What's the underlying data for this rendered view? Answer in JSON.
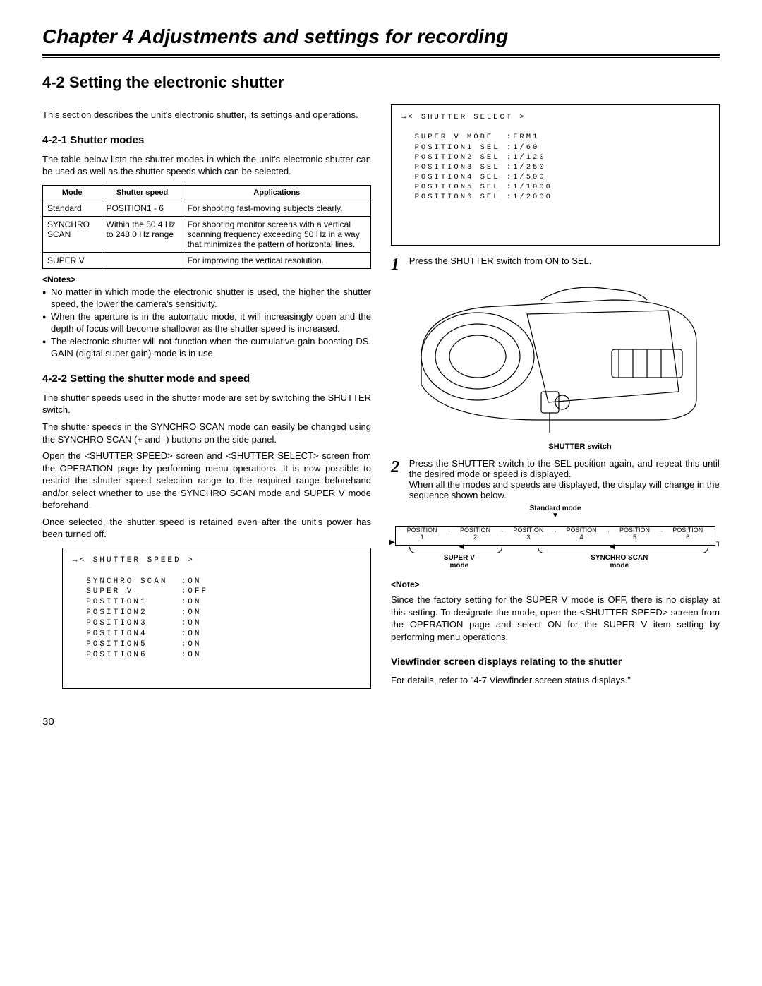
{
  "chapter_title": "Chapter 4  Adjustments and settings for recording",
  "section_title": "4-2 Setting the electronic shutter",
  "intro": "This section describes the unit's electronic shutter, its settings and operations.",
  "sub_4_2_1": "4-2-1 Shutter modes",
  "modes_intro": "The table below lists the shutter modes in which the unit's electronic shutter can be used as well as the shutter speeds which can be selected.",
  "table": {
    "headers": [
      "Mode",
      "Shutter speed",
      "Applications"
    ],
    "rows": [
      {
        "mode": "Standard",
        "speed": "POSITION1 - 6",
        "app": "For shooting fast-moving subjects clearly."
      },
      {
        "mode": "SYNCHRO SCAN",
        "speed": "Within the 50.4 Hz to 248.0 Hz range",
        "app": "For shooting monitor screens with a vertical scanning frequency exceeding 50 Hz in a way that minimizes the pattern of horizontal lines."
      },
      {
        "mode": "SUPER V",
        "speed": "",
        "app": "For improving the vertical resolution."
      }
    ]
  },
  "notes_label": "<Notes>",
  "notes": [
    "No matter in which mode the electronic shutter is used, the higher the shutter speed, the lower the camera's sensitivity.",
    "When the aperture is in the automatic mode, it will increasingly open and the depth of focus will become shallower as the shutter speed is increased.",
    "The electronic shutter will not function when the cumulative gain-boosting DS. GAIN (digital super gain) mode is in use."
  ],
  "sub_4_2_2": "4-2-2 Setting the shutter mode and speed",
  "p422_1": "The shutter speeds used in the shutter mode are set by switching the SHUTTER switch.",
  "p422_2": "The shutter speeds in the SYNCHRO SCAN mode can easily be changed using the SYNCHRO SCAN (+ and -) buttons on the side panel.",
  "p422_3": "Open the <SHUTTER SPEED> screen and <SHUTTER SELECT> screen from the OPERATION page by performing menu operations.  It is now possible to restrict the shutter speed selection range to the required range beforehand and/or select whether to use the SYNCHRO SCAN mode and SUPER V mode beforehand.",
  "p422_4": "Once selected, the shutter speed is retained even after the unit's power has been turned off.",
  "menu_speed_title": "→< SHUTTER SPEED >",
  "menu_speed_lines": [
    "SYNCHRO SCAN  :ON",
    "SUPER V       :OFF",
    "POSITION1     :ON",
    "POSITION2     :ON",
    "POSITION3     :ON",
    "POSITION4     :ON",
    "POSITION5     :ON",
    "POSITION6     :ON"
  ],
  "menu_select_title": "→< SHUTTER SELECT >",
  "menu_select_lines": [
    "SUPER V MODE  :FRM1",
    "POSITION1 SEL :1/60",
    "POSITION2 SEL :1/120",
    "POSITION3 SEL :1/250",
    "POSITION4 SEL :1/500",
    "POSITION5 SEL :1/1000",
    "POSITION6 SEL :1/2000"
  ],
  "step1": "Press the SHUTTER switch from ON to SEL.",
  "shutter_switch_label": "SHUTTER switch",
  "step2a": "Press the SHUTTER switch to the SEL position again, and repeat this until the desired mode or speed is displayed.",
  "step2b": "When all the modes and speeds are displayed, the display will change in the sequence shown below.",
  "seq_standard": "Standard mode",
  "seq_positions": [
    "POSITION\n1",
    "POSITION\n2",
    "POSITION\n3",
    "POSITION\n4",
    "POSITION\n5",
    "POSITION\n6"
  ],
  "seq_superv": "SUPER V\nmode",
  "seq_synchro": "SYNCHRO SCAN\nmode",
  "note_single_label": "<Note>",
  "note_single_text": "Since the factory setting for the SUPER V mode is OFF, there is no display at this setting. To designate the mode, open the <SHUTTER SPEED> screen from the OPERATION page and select ON for the SUPER V item setting by performing menu operations.",
  "vf_heading": "Viewfinder screen displays relating to the shutter",
  "vf_text": "For details, refer to \"4-7 Viewfinder screen status displays.\"",
  "page_number": "30"
}
